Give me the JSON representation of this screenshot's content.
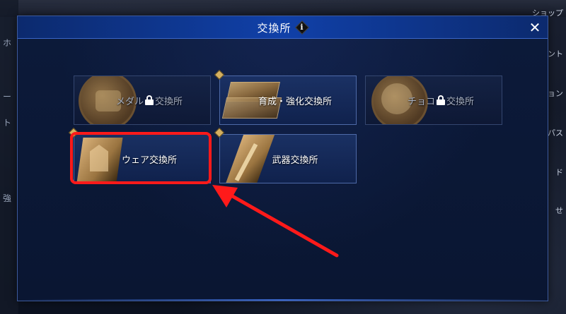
{
  "background": {
    "right_items": [
      "ショップ",
      "ント",
      "ョン",
      "パス",
      "ド",
      "せ"
    ],
    "left_items": [
      "ホ",
      "ー",
      "ト",
      "強"
    ]
  },
  "modal": {
    "title": "交換所",
    "info_icon": "info-icon",
    "close_icon": "close-icon",
    "close_label": "✕"
  },
  "tiles": [
    {
      "label_pre": "メダル",
      "label_post": "交換所",
      "locked": true,
      "new_badge": false,
      "art": "medal-coin"
    },
    {
      "label": "育成・強化交換所",
      "locked": false,
      "new_badge": true,
      "art": "gold-bar"
    },
    {
      "label_pre": "チョコ",
      "label_post": "交換所",
      "locked": true,
      "new_badge": false,
      "art": "choco-coin"
    },
    {
      "label": "ウェア交換所",
      "locked": false,
      "new_badge": true,
      "art": "wear-cloth",
      "highlighted": true
    },
    {
      "label": "武器交換所",
      "locked": false,
      "new_badge": true,
      "art": "weapon"
    }
  ],
  "colors": {
    "header": "#1040a8",
    "tile_border": "#4e6aa8",
    "highlight": "#ff1a1a",
    "badge": "#d4b060"
  }
}
